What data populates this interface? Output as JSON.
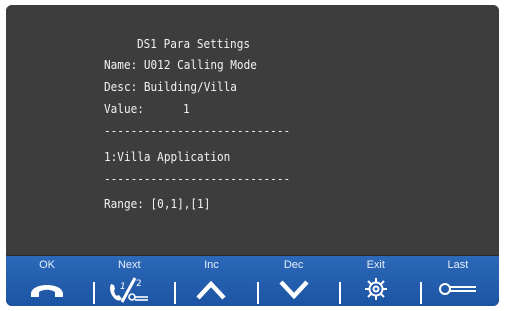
{
  "screen": {
    "title": "DS1 Para Settings",
    "name": "Name: U012 Calling Mode",
    "desc": "Desc: Building/Villa",
    "value_label": "Value:",
    "value": "1",
    "divider": "----------------------------",
    "option": "1:Villa Application",
    "range": "Range: [0,1],[1]"
  },
  "softkeys": [
    {
      "label": "OK",
      "icon": "handset-icon"
    },
    {
      "label": "Next",
      "icon": "phone-sequence-icon"
    },
    {
      "label": "Inc",
      "icon": "chevron-up-icon"
    },
    {
      "label": "Dec",
      "icon": "chevron-down-icon"
    },
    {
      "label": "Exit",
      "icon": "gear-icon"
    },
    {
      "label": "Last",
      "icon": "key-icon"
    }
  ],
  "colors": {
    "screen_bg": "#3d3d3d",
    "softkey_bar": "#2260ae",
    "text": "#f2f2f2"
  }
}
